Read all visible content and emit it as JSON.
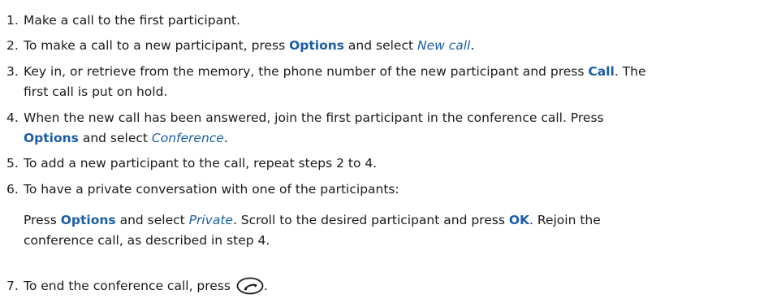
{
  "steps": [
    {
      "num": "1.",
      "text": "Make a call to the first participant."
    },
    {
      "num": "2.",
      "a": "To make a call to a new participant, press ",
      "k1": "Options",
      "b": " and select ",
      "m1": "New call",
      "c": "."
    },
    {
      "num": "3.",
      "a": "Key in, or  retrieve  from the memory, the phone number of the new participant and press ",
      "k1": "Call",
      "b": ". The",
      "line2": "first call is put on hold."
    },
    {
      "num": "4.",
      "a": "When the new call has been answered, join the first participant in the conference call. Press",
      "k1": "Options",
      "b": " and select ",
      "m1": "Conference",
      "c": "."
    },
    {
      "num": "5.",
      "text": "To add a new participant to the call, repeat steps 2 to 4."
    },
    {
      "num": "6.",
      "text": "To have a private conversation with one of the participants:",
      "p_a": "Press ",
      "p_k1": "Options",
      "p_b": " and select ",
      "p_m1": "Private",
      "p_c": ". Scroll to the desired participant and press ",
      "p_k2": "OK",
      "p_d": ". Rejoin the",
      "p_line2": "conference call, as described in step 4."
    },
    {
      "num": "7.",
      "text": "To end the conference call, press ",
      "icon": "end-call-key-icon",
      "end": "."
    }
  ]
}
